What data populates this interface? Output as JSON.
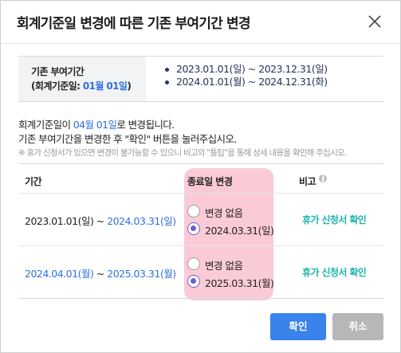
{
  "dialog": {
    "title": "회계기준일 변경에 따른 기존 부여기간 변경"
  },
  "info": {
    "label_line1": "기존 부여기간",
    "label_prefix": "(회계기준일: ",
    "label_date": "01월 01일",
    "label_suffix": ")",
    "periods": [
      "2023.01.01(일) ~ 2023.12.31(일)",
      "2024.01.01(월) ~ 2024.12.31(화)"
    ]
  },
  "message": {
    "line1_prefix": "회계기준일이 ",
    "line1_date": "04월 01일",
    "line1_suffix": "로 변경됩니다.",
    "line2": "기존 부여기간을 변경한 후 \"확인\" 버튼을 눌러주십시오.",
    "note": "※ 휴가 신청서가 있으면 변경이 불가능할 수 있으니 비고의 \"툴팁\"을 통해 상세 내용을 확인해 주십시오."
  },
  "table": {
    "headers": [
      "기간",
      "종료일 변경",
      "비고"
    ],
    "info_icon_glyph": "i",
    "rows": [
      {
        "period_start": "2023.01.01(일)",
        "period_sep": " ~ ",
        "period_end": "2024.03.31(일)",
        "option_none": "변경 없음",
        "option_date": "2024.03.31(일)",
        "selected": "date",
        "memo": "휴가 신청서 확인"
      },
      {
        "period_start": "2024.04.01(월)",
        "period_sep": " ~ ",
        "period_end": "2025.03.31(월)",
        "option_none": "변경 없음",
        "option_date": "2025.03.31(월)",
        "selected": "date",
        "memo": "휴가 신청서 확인"
      }
    ]
  },
  "buttons": {
    "ok": "확인",
    "cancel": "취소"
  },
  "colors": {
    "accent": "#3a82ec",
    "link_blue": "#2f6fe4",
    "memo_teal": "#1bb5ad",
    "radio_purple": "#6a5fcf",
    "highlight": "#ec466e"
  }
}
